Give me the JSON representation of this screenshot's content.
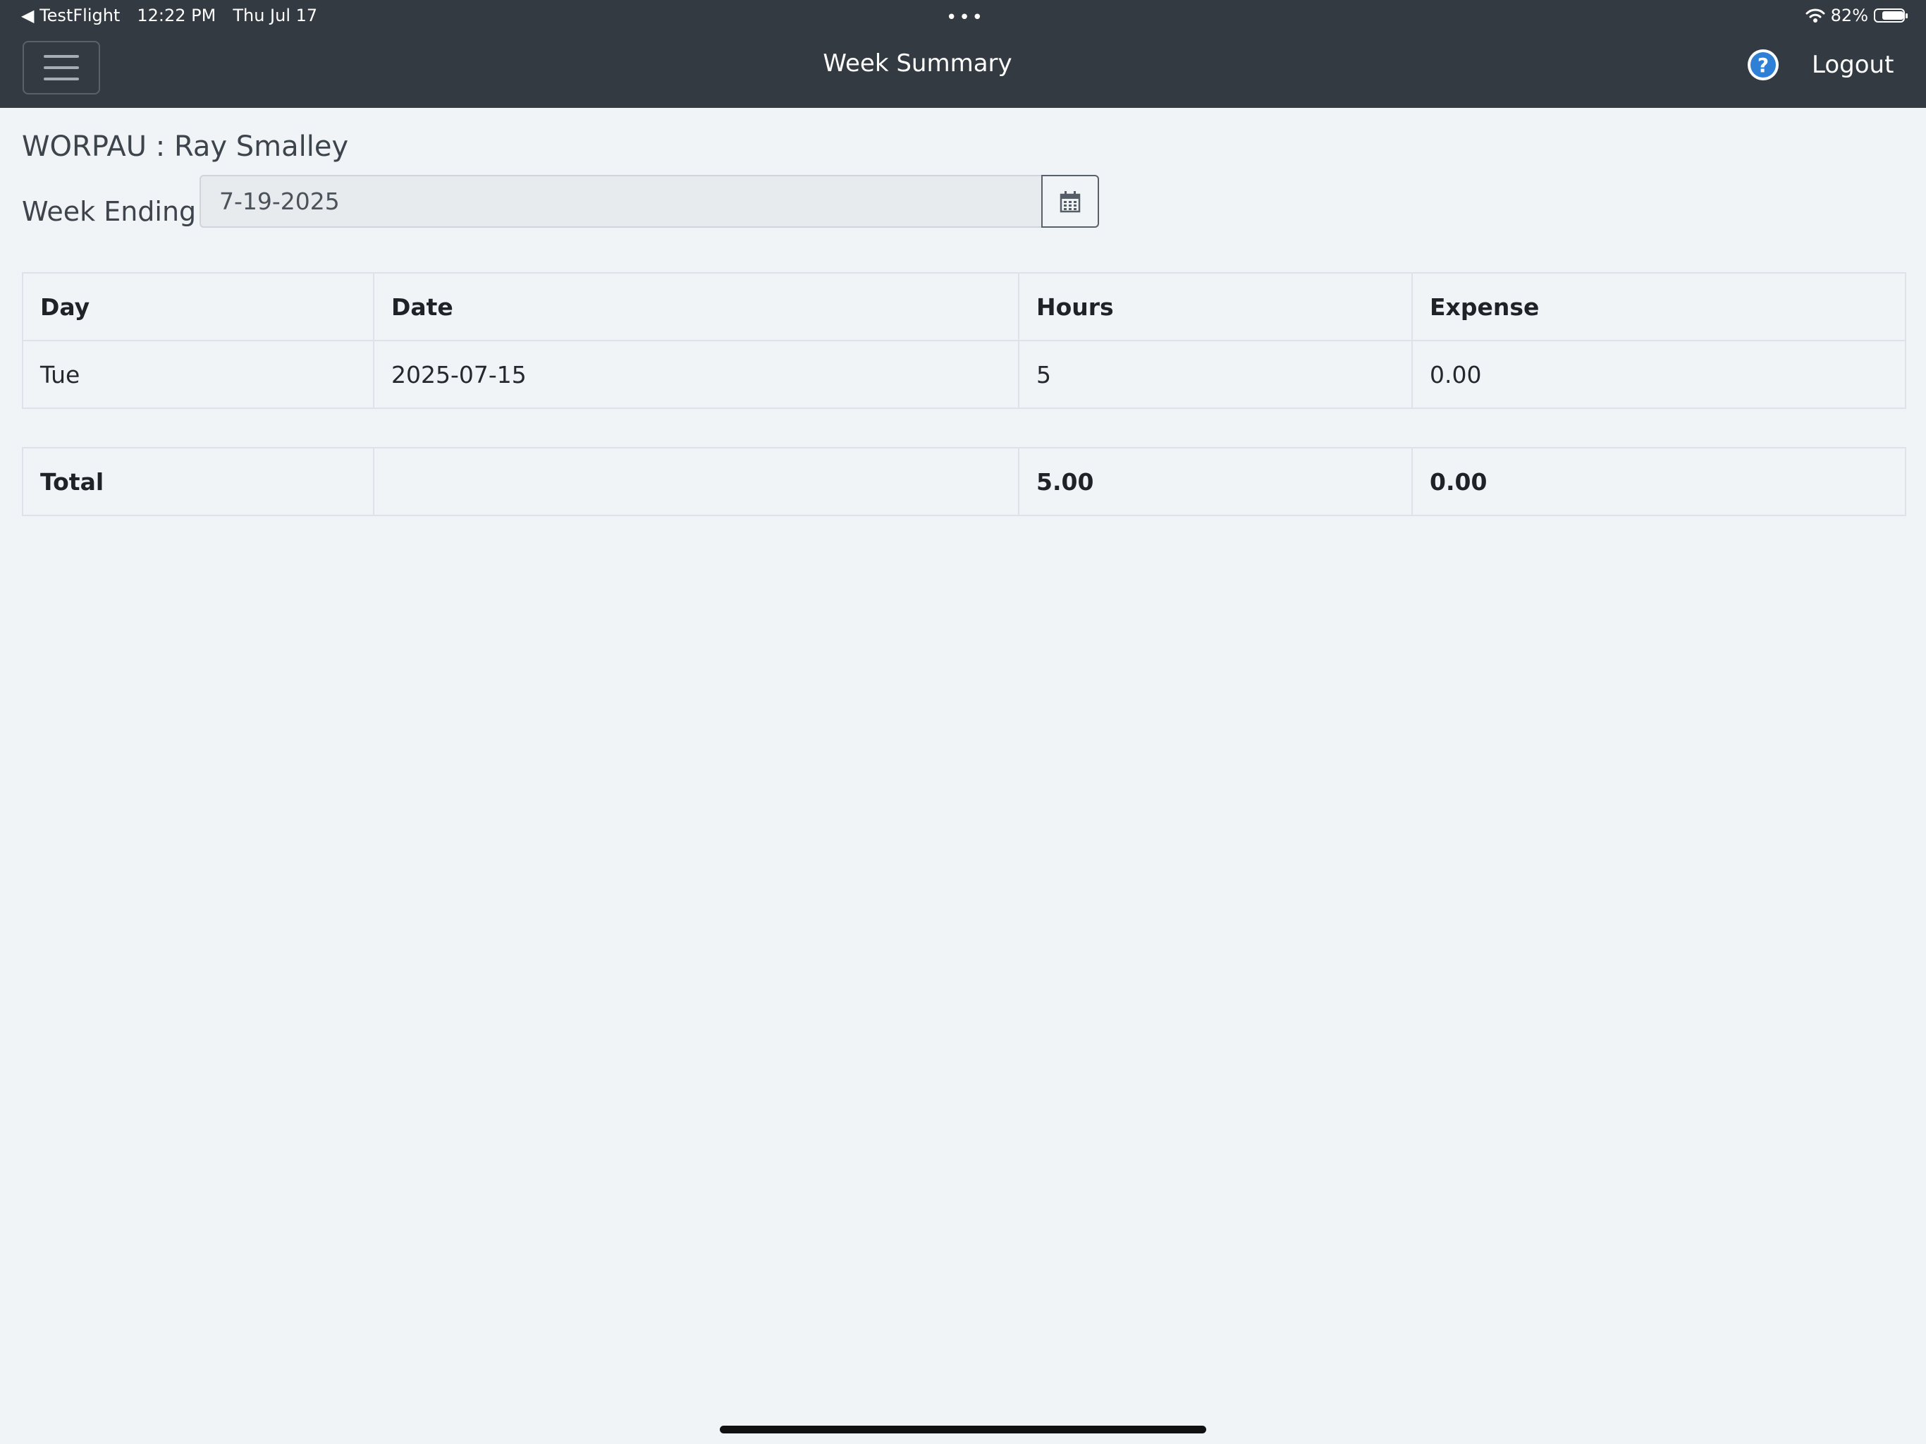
{
  "status_bar": {
    "back_app": "◀ TestFlight",
    "time": "12:22 PM",
    "date": "Thu Jul 17",
    "dots": "•••",
    "battery": "82%",
    "battery_level": 0.82
  },
  "header": {
    "title": "Week Summary",
    "logout_label": "Logout",
    "help_glyph": "?"
  },
  "page": {
    "title": "WORPAU : Ray Smalley",
    "week_ending_label": "Week Ending",
    "week_ending_value": "7-19-2025"
  },
  "table": {
    "headers": [
      "Day",
      "Date",
      "Hours",
      "Expense"
    ],
    "rows": [
      [
        "Tue",
        "2025-07-15",
        "5",
        "0.00"
      ]
    ]
  },
  "totals": {
    "label": "Total",
    "date": "",
    "hours": "5.00",
    "expense": "0.00"
  },
  "icons": {
    "menu": "hamburger-menu-icon",
    "help": "help-circle-icon",
    "calendar": "calendar-icon",
    "wifi": "wifi-icon",
    "battery": "battery-icon"
  },
  "colors": {
    "header_bg": "#343a42",
    "page_bg": "#f0f4f7",
    "help_blue": "#2e7fd6"
  }
}
